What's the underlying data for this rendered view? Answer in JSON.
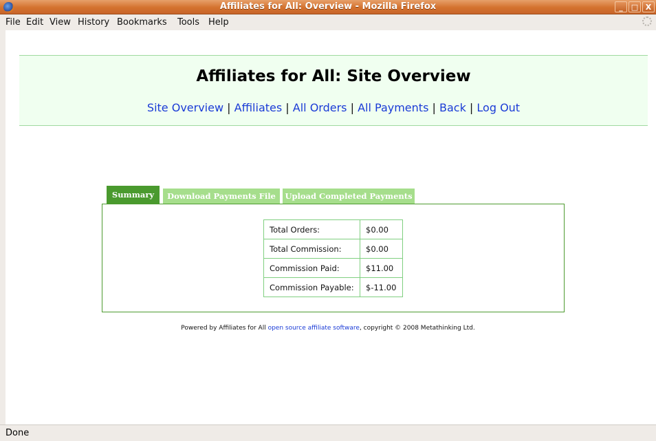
{
  "window": {
    "title": "Affiliates for All: Overview - Mozilla Firefox",
    "controls": [
      "_",
      "□",
      "X"
    ]
  },
  "menu": [
    "File",
    "Edit",
    "View",
    "History",
    "Bookmarks",
    "Tools",
    "Help"
  ],
  "header": {
    "title": "Affiliates for All: Site Overview",
    "nav": [
      "Site Overview",
      "Affiliates",
      "All Orders",
      "All Payments",
      "Back",
      "Log Out"
    ],
    "separator": "|"
  },
  "tabs": [
    {
      "label": "Summary",
      "active": true
    },
    {
      "label": "Download Payments File",
      "active": false
    },
    {
      "label": "Upload Completed Payments",
      "active": false
    }
  ],
  "summary": {
    "rows": [
      {
        "label": "Total Orders:",
        "value": "$0.00"
      },
      {
        "label": "Total Commission:",
        "value": "$0.00"
      },
      {
        "label": "Commission Paid:",
        "value": "$11.00"
      },
      {
        "label": "Commission Payable:",
        "value": "$-11.00"
      }
    ]
  },
  "footer": {
    "prefix": "Powered by Affiliates for All ",
    "link": "open source affiliate software",
    "suffix": ", copyright © 2008 Metathinking Ltd."
  },
  "status": "Done",
  "colors": {
    "accent_green": "#4a9a2e",
    "tab_inactive": "#a6de8c",
    "link_blue": "#1a3bd6",
    "header_bg": "#f0fff0",
    "titlebar": "#d4722e"
  }
}
